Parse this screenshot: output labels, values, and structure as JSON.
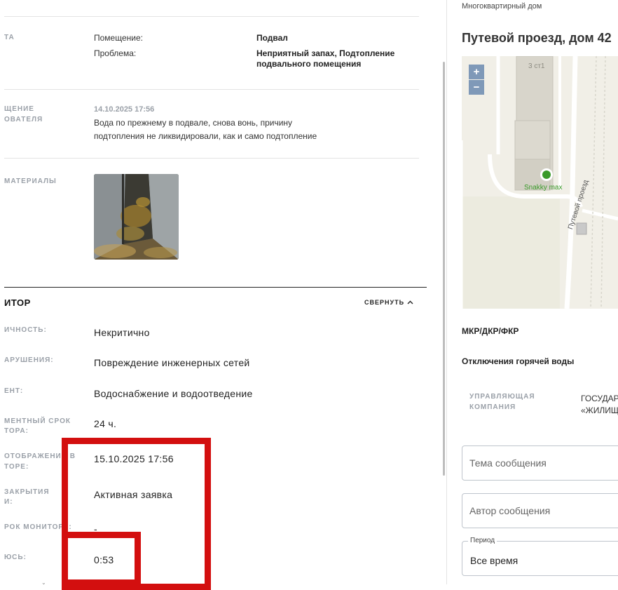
{
  "details": {
    "object_label": "ТА",
    "room_label": "Помещение:",
    "room_value": "Подвал",
    "problem_label": "Проблема:",
    "problem_value_line1": "Неприятный запах, Подтопление",
    "problem_value_line2": "подвального помещения",
    "message_label_line1": "ЩЕНИЕ",
    "message_label_line2": "ОВАТЕЛЯ",
    "message_date": "14.10.2025 17:56",
    "message_line1": "Вода по прежнему в подвале, снова вонь, причину",
    "message_line2": "подтопления не ликвидировали, как и само подтопление",
    "materials_label": "МАТЕРИАЛЫ"
  },
  "monitor": {
    "title": "ИТОР",
    "collapse_label": "СВЕРНУТЬ",
    "rows": [
      {
        "label_line1": "ИЧНОСТЬ:",
        "label_line2": "",
        "value": "Некритично"
      },
      {
        "label_line1": "АРУШЕНИЯ:",
        "label_line2": "",
        "value": "Повреждение инженерных сетей"
      },
      {
        "label_line1": "ЕНТ:",
        "label_line2": "",
        "value": "Водоснабжение и водоотведение"
      },
      {
        "label_line1": "МЕНТНЫЙ СРОК",
        "label_line2": "ТОРА:",
        "value": "24 ч."
      },
      {
        "label_line1": "ОТОБРАЖЕНИЯ В",
        "label_line2": "ТОРЕ:",
        "value": "15.10.2025 17:56"
      },
      {
        "label_line1": "ЗАКРЫТИЯ",
        "label_line2": "И:",
        "value": "Активная заявка"
      },
      {
        "label_line1": "РОК МОНИТОРА:",
        "label_line2": "",
        "value": "-"
      },
      {
        "label_line1": "ЮСЬ:",
        "label_line2": "",
        "value": "0:53"
      }
    ]
  },
  "sidebar": {
    "subtitle": "Многоквартирный дом",
    "address": "Путевой проезд, дом 42",
    "map": {
      "building_label": "3 ст1",
      "poi_label": "Snakky max",
      "street_label": "Путевой проезд",
      "zoom_in": "+",
      "zoom_out": "−"
    },
    "programs": "МКР/ДКР/ФКР",
    "outage": "Отключения горячей воды",
    "company_label_line1": "УПРАВЛЯЮЩАЯ",
    "company_label_line2": "КОМПАНИЯ",
    "company_value_line1": "ГОСУДАРСТВЕННОЕ",
    "company_value_line2": "«ЖИЛИЩНИК",
    "subject_placeholder": "Тема сообщения",
    "author_placeholder": "Автор сообщения",
    "period_label": "Период",
    "period_value": "Все время"
  },
  "colors": {
    "highlight": "#d30f0f",
    "map_zoom": "#7f99b8",
    "poi_green": "#3a9a2a"
  }
}
